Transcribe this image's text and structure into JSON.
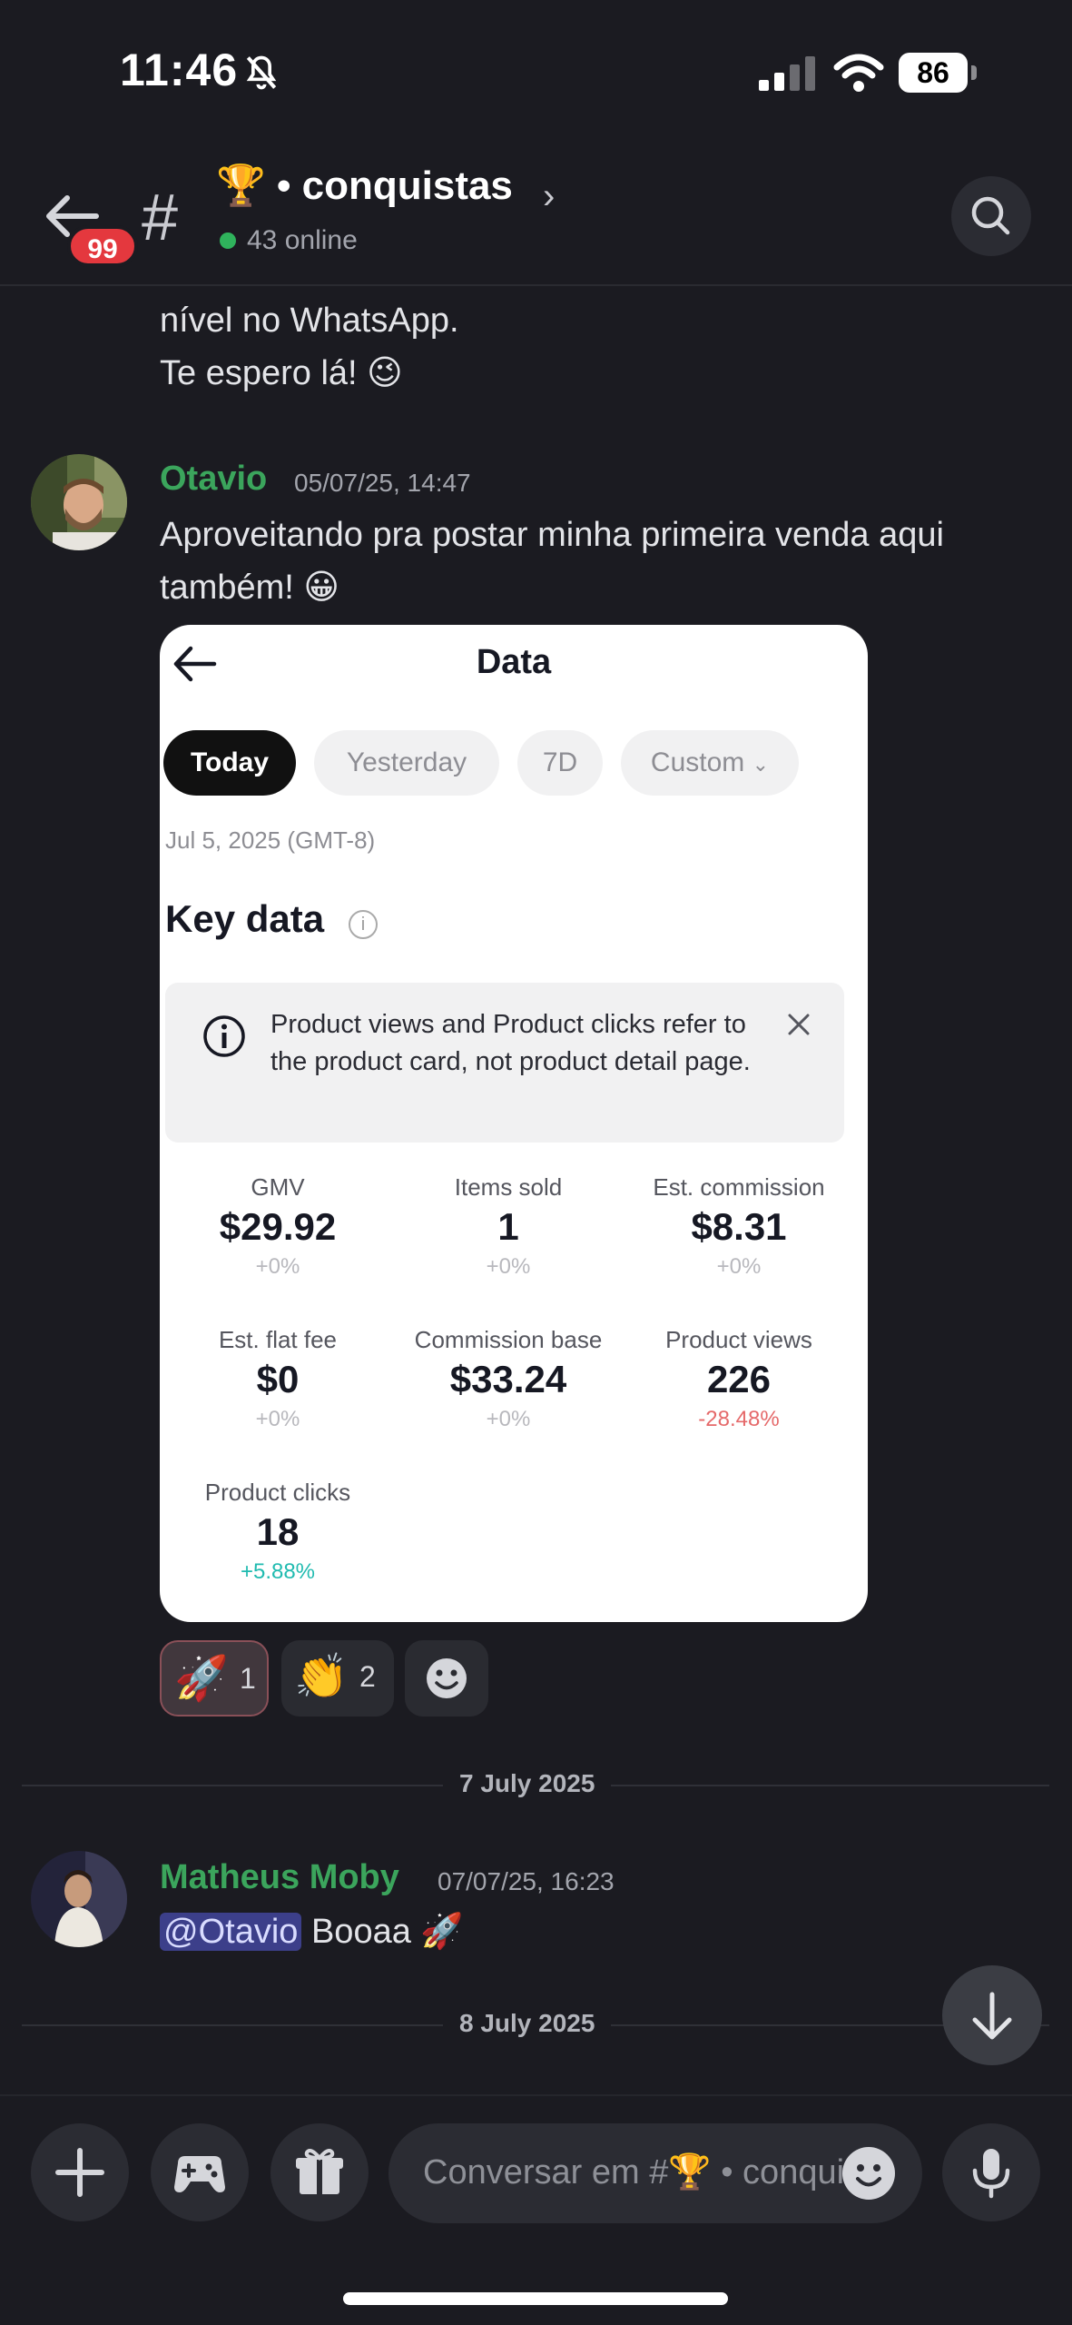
{
  "status_bar": {
    "time": "11:46",
    "battery": "86"
  },
  "header": {
    "unread_badge": "99",
    "channel_prefix": "#",
    "channel_name": "🏆 • conquistas",
    "online": "43 online"
  },
  "previous_message": {
    "lines": [
      "nível no WhatsApp.",
      "Te espero lá! 😉"
    ]
  },
  "messages": [
    {
      "author": "Otavio",
      "time": "05/07/25, 14:47",
      "text": "Aproveitando pra postar minha primeira venda aqui também! 😀"
    },
    {
      "author": "Matheus Moby",
      "time": "07/07/25, 16:23",
      "mention": "@Otavio",
      "text": " Booaa 🚀"
    }
  ],
  "embedded_screenshot": {
    "title": "Data",
    "tabs": [
      "Today",
      "Yesterday",
      "7D",
      "Custom"
    ],
    "active_tab": "Today",
    "date": "Jul 5, 2025 (GMT-8)",
    "section_title": "Key data",
    "notice": "Product views and Product clicks refer to the product card, not product detail page.",
    "metrics": [
      {
        "label": "GMV",
        "value": "$29.92",
        "change": "+0%"
      },
      {
        "label": "Items sold",
        "value": "1",
        "change": "+0%"
      },
      {
        "label": "Est. commission",
        "value": "$8.31",
        "change": "+0%"
      },
      {
        "label": "Est. flat fee",
        "value": "$0",
        "change": "+0%"
      },
      {
        "label": "Commission base",
        "value": "$33.24",
        "change": "+0%"
      },
      {
        "label": "Product views",
        "value": "226",
        "change": "-28.48%"
      },
      {
        "label": "Product clicks",
        "value": "18",
        "change": "+5.88%"
      }
    ]
  },
  "reactions": [
    {
      "emoji": "🚀",
      "count": "1"
    },
    {
      "emoji": "👏",
      "count": "2"
    }
  ],
  "dividers": [
    "7 July 2025",
    "8 July 2025"
  ],
  "composer": {
    "placeholder": "Conversar em #🏆 • conquistas"
  },
  "colors": {
    "background": "#1b1b21",
    "author_green": "#3ba55c",
    "badge_red": "#e4383e",
    "mention_bg": "#3c3f8a"
  },
  "icons": [
    "back-arrow-icon",
    "bell-off-icon",
    "search-icon",
    "plus-icon",
    "gamepad-icon",
    "gift-icon",
    "emoji-icon",
    "microphone-icon",
    "arrow-down-icon",
    "info-icon",
    "close-icon"
  ]
}
